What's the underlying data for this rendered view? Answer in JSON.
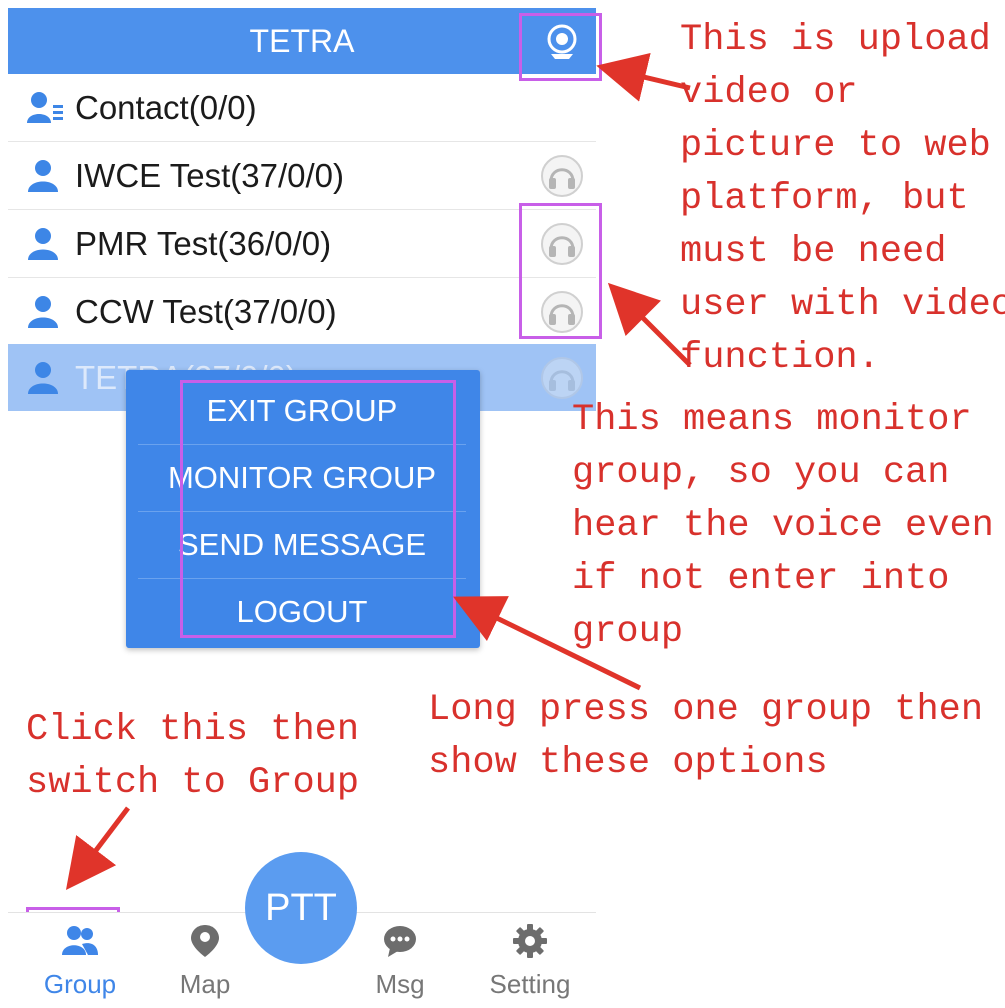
{
  "header": {
    "title": "TETRA",
    "upload_icon": "webcam-upload-icon"
  },
  "contact_row": {
    "label": "Contact(0/0)",
    "icon": "contact-list-icon"
  },
  "groups": [
    {
      "label": "IWCE Test(37/0/0)",
      "icon": "user-icon",
      "monitor_icon": "headphones-icon"
    },
    {
      "label": "PMR Test(36/0/0)",
      "icon": "user-icon",
      "monitor_icon": "headphones-icon"
    },
    {
      "label": "CCW Test(37/0/0)",
      "icon": "user-icon",
      "monitor_icon": "headphones-icon"
    },
    {
      "label": "TETRA(37/0/0)",
      "icon": "user-icon",
      "monitor_icon": "headphones-icon"
    }
  ],
  "context_menu": {
    "items": [
      "EXIT GROUP",
      "MONITOR GROUP",
      "SEND MESSAGE",
      "LOGOUT"
    ]
  },
  "annotations": {
    "upload": "This is upload\nvideo or\npicture to web\nplatform, but\nmust be need\nuser with video\nfunction.",
    "monitor": "This means monitor\ngroup, so you can\nhear the voice even\nif not enter into\ngroup",
    "long_press": "Long press one group then\nshow these options",
    "group_tab": "Click this then\nswitch to Group"
  },
  "bottom_nav": {
    "tabs": [
      {
        "label": "Group",
        "icon": "group-icon",
        "active": true
      },
      {
        "label": "Map",
        "icon": "map-pin-icon",
        "active": false
      },
      {
        "label": "Msg",
        "icon": "chat-bubble-icon",
        "active": false
      },
      {
        "label": "Setting",
        "icon": "gear-icon",
        "active": false
      }
    ],
    "ptt_label": "PTT"
  },
  "colors": {
    "primary_blue": "#4d91ec",
    "menu_blue": "#3f86e8",
    "selected_row": "#9fc3f5",
    "annotation_red": "#d8312c",
    "highlight_box": "#c85fe8"
  }
}
